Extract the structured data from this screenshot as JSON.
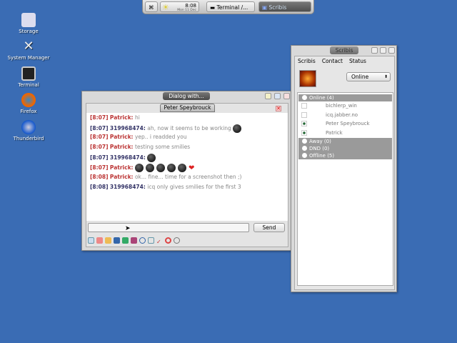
{
  "desktop": {
    "icons": [
      {
        "label": "Storage"
      },
      {
        "label": "System Manager"
      },
      {
        "label": "Terminal"
      },
      {
        "label": "Firefox"
      },
      {
        "label": "Thunderbird"
      }
    ]
  },
  "taskbar": {
    "time": "8:08",
    "date": "Mon 11 Dec",
    "tasks": [
      {
        "label": "Terminal /..."
      },
      {
        "label": "Scribis"
      }
    ]
  },
  "chat": {
    "title": "Dialog with...",
    "tab": "Peter Speybrouck",
    "messages": [
      {
        "time": "[8:07]",
        "name": "Patrick:",
        "text": "hi",
        "who": "red"
      },
      {
        "time": "[8:07]",
        "name": "319968474:",
        "text": "ah, now it seems to be working",
        "who": "blue",
        "smilies": 1
      },
      {
        "time": "[8:07]",
        "name": "Patrick:",
        "text": "yep.. i readded you",
        "who": "red"
      },
      {
        "time": "[8:07]",
        "name": "Patrick:",
        "text": "testing some smilies",
        "who": "red"
      },
      {
        "time": "[8:07]",
        "name": "319968474:",
        "text": "",
        "who": "blue",
        "smilies": 1
      },
      {
        "time": "[8:07]",
        "name": "Patrick:",
        "text": "",
        "who": "red",
        "smilies": 5,
        "heart": true
      },
      {
        "time": "[8:08]",
        "name": "Patrick:",
        "text": "ok... fine... time for a screenshot then ;)",
        "who": "red"
      },
      {
        "time": "[8:08]",
        "name": "319968474:",
        "text": "icq only gives smilies for the first 3",
        "who": "blue"
      }
    ],
    "input_value": "",
    "send_label": "Send"
  },
  "scribis": {
    "title": "Scribis",
    "menu": [
      "Scribis",
      "Contact",
      "Status"
    ],
    "status": "Online",
    "groups": [
      {
        "label": "Online (4)",
        "contacts": [
          {
            "name": "bichlerp_win",
            "online": false
          },
          {
            "name": "icq.jabber.no",
            "online": false
          },
          {
            "name": "Peter Speybrouck",
            "online": true
          },
          {
            "name": "Patrick",
            "online": true
          }
        ]
      },
      {
        "label": "Away (0)"
      },
      {
        "label": "DND (0)"
      },
      {
        "label": "Offline (5)"
      }
    ]
  }
}
